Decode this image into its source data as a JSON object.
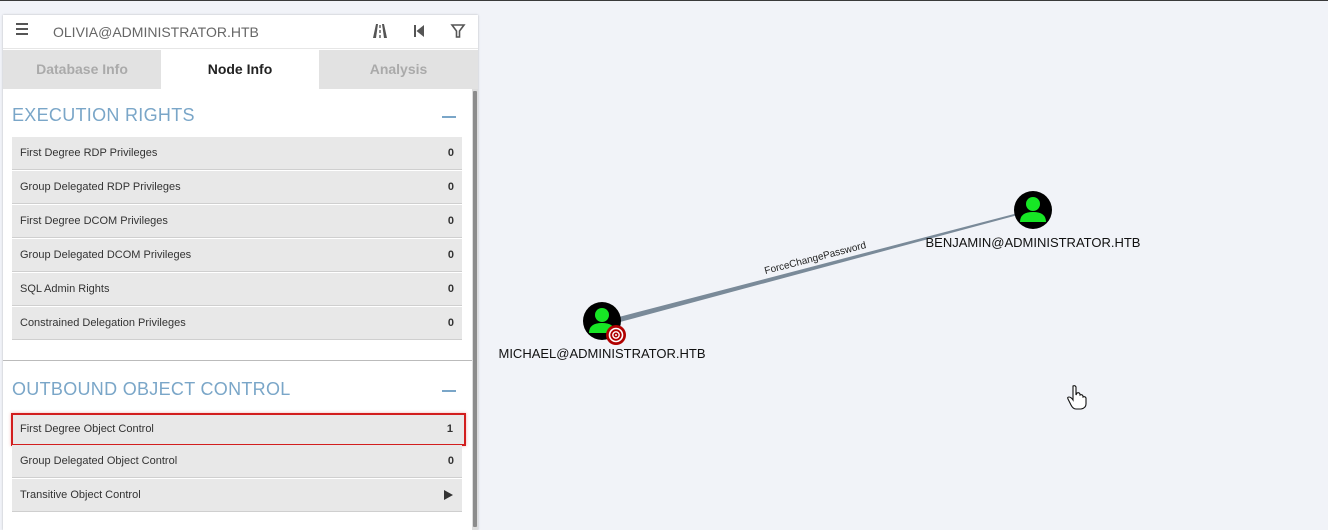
{
  "search": {
    "value": "OLIVIA@ADMINISTRATOR.HTB"
  },
  "toolbar": {
    "menu_icon": "hamburger-icon",
    "pathfinding_icon": "road-icon",
    "back_icon": "skip-back-icon",
    "filter_icon": "filter-icon"
  },
  "tabs": [
    {
      "label": "Database Info",
      "active": false
    },
    {
      "label": "Node Info",
      "active": true
    },
    {
      "label": "Analysis",
      "active": false
    }
  ],
  "sections": [
    {
      "title": "EXECUTION RIGHTS",
      "rows": [
        {
          "label": "First Degree RDP Privileges",
          "value": "0"
        },
        {
          "label": "Group Delegated RDP Privileges",
          "value": "0"
        },
        {
          "label": "First Degree DCOM Privileges",
          "value": "0"
        },
        {
          "label": "Group Delegated DCOM Privileges",
          "value": "0"
        },
        {
          "label": "SQL Admin Rights",
          "value": "0"
        },
        {
          "label": "Constrained Delegation Privileges",
          "value": "0"
        }
      ]
    },
    {
      "title": "OUTBOUND OBJECT CONTROL",
      "rows": [
        {
          "label": "First Degree Object Control",
          "value": "1",
          "highlighted": true
        },
        {
          "label": "Group Delegated Object Control",
          "value": "0"
        },
        {
          "label": "Transitive Object Control",
          "value": ""
        }
      ]
    }
  ],
  "graph": {
    "nodes": [
      {
        "label": "BENJAMIN@ADMINISTRATOR.HTB",
        "icon": "user-icon",
        "target": false
      },
      {
        "label": "MICHAEL@ADMINISTRATOR.HTB",
        "icon": "user-icon",
        "target": true
      }
    ],
    "edges": [
      {
        "label": "ForceChangePassword"
      }
    ]
  },
  "colors": {
    "background": "#f1f3f8",
    "user_node_fill": "#17e625",
    "node_bg": "#000000",
    "edge": "#7a8a99",
    "section_title": "#7aa6c8",
    "highlight_border": "#d21e1e",
    "target_badge": "#b00000"
  }
}
